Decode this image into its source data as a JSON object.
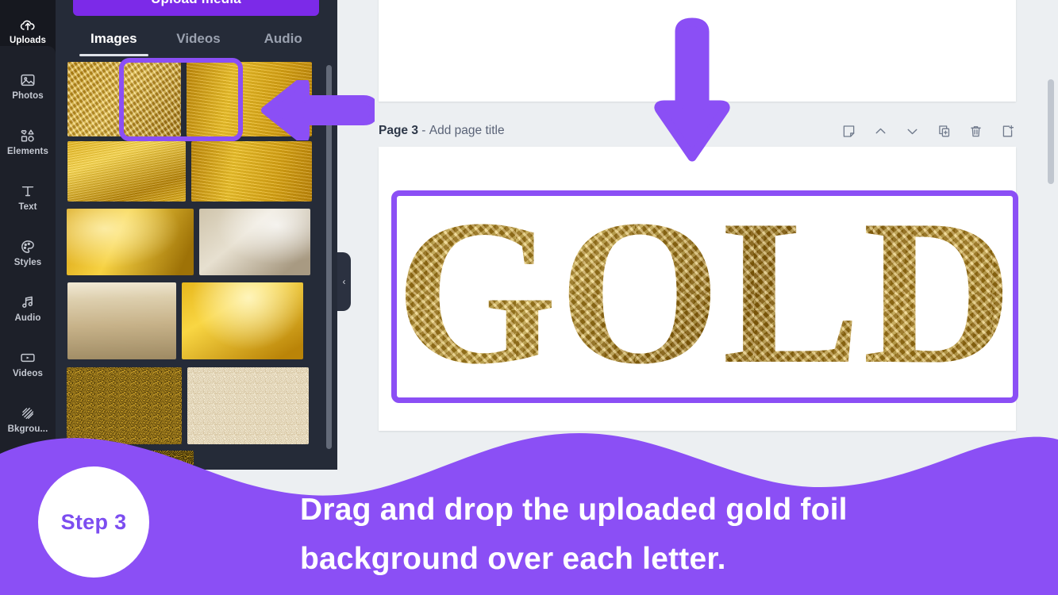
{
  "accent_purple": "#8b4ff5",
  "banner_purple": "#8b4ff5",
  "button_purple": "#7c2ae8",
  "rail": {
    "items": [
      {
        "label": "Uploads",
        "icon": "cloud-upload-icon",
        "active": true
      },
      {
        "label": "Photos",
        "icon": "photo-icon",
        "active": false
      },
      {
        "label": "Elements",
        "icon": "shapes-icon",
        "active": false
      },
      {
        "label": "Text",
        "icon": "text-icon",
        "active": false
      },
      {
        "label": "Styles",
        "icon": "palette-icon",
        "active": false
      },
      {
        "label": "Audio",
        "icon": "music-note-icon",
        "active": false
      },
      {
        "label": "Videos",
        "icon": "video-icon",
        "active": false
      },
      {
        "label": "Bkgrou...",
        "icon": "hatch-pattern-icon",
        "active": false
      }
    ]
  },
  "panel": {
    "upload_button": "Upload media",
    "tabs": [
      {
        "label": "Images",
        "active": true
      },
      {
        "label": "Videos",
        "active": false
      },
      {
        "label": "Audio",
        "active": false
      }
    ],
    "thumbnails": [
      {
        "name": "crumpled-gold-foil",
        "selected": true
      },
      {
        "name": "gold-foil-sheen",
        "selected": false
      },
      {
        "name": "gold-gradient-panel",
        "selected": false
      },
      {
        "name": "bright-gold-sheet",
        "selected": false
      },
      {
        "name": "soft-gold-blur",
        "selected": false
      },
      {
        "name": "pale-marble-gold",
        "selected": false
      },
      {
        "name": "brushed-champagne",
        "selected": false
      },
      {
        "name": "glowing-gold-cloud",
        "selected": false
      },
      {
        "name": "gold-glitter-dark",
        "selected": false
      },
      {
        "name": "pale-gold-fibre",
        "selected": false
      },
      {
        "name": "dark-gold-flakes",
        "selected": false
      }
    ],
    "collapse_icon": "chevron-left-icon"
  },
  "editor": {
    "page_label": "Page 3",
    "page_separator": "-",
    "page_title_placeholder": "Add page title",
    "tools": [
      {
        "name": "notes-icon",
        "label": "Notes"
      },
      {
        "name": "chevron-up-icon",
        "label": "Move page up"
      },
      {
        "name": "chevron-down-icon",
        "label": "Move page down"
      },
      {
        "name": "duplicate-page-icon",
        "label": "Duplicate page"
      },
      {
        "name": "trash-icon",
        "label": "Delete page"
      },
      {
        "name": "add-page-icon",
        "label": "Add page"
      }
    ],
    "canvas_text": "GOLD"
  },
  "annotations": {
    "arrow_left": "left-pointing-arrow",
    "arrow_down": "down-pointing-arrow"
  },
  "banner": {
    "step_badge": "Step 3",
    "caption_line_1": "Drag and drop the uploaded gold foil",
    "caption_line_2": "background over each letter."
  }
}
